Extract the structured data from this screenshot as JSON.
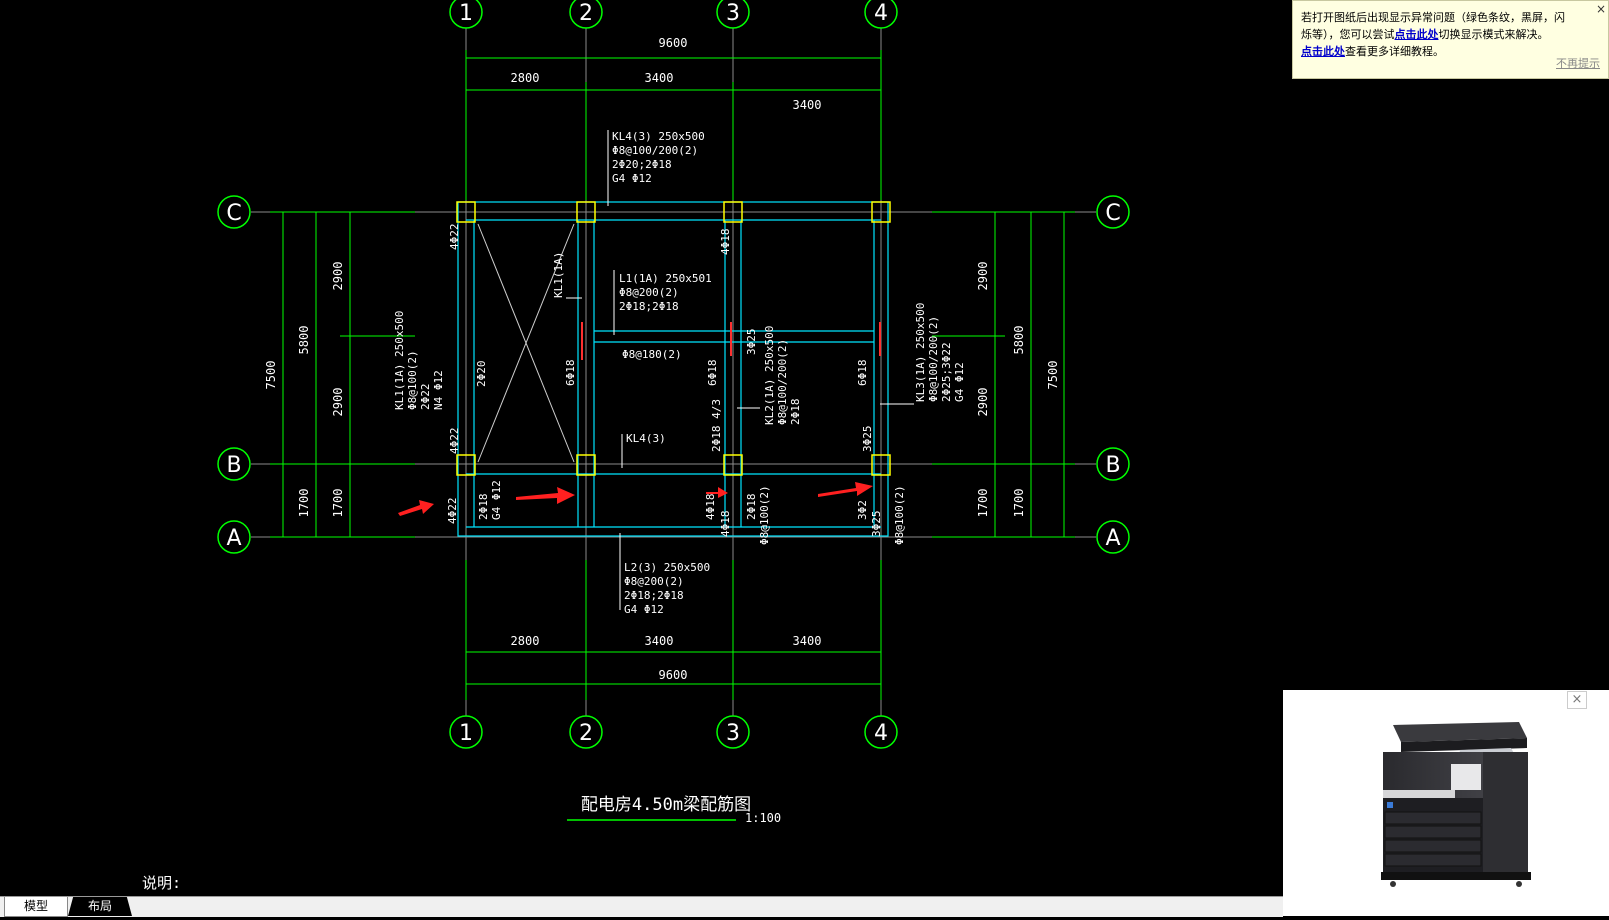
{
  "drawing": {
    "grid_labels": {
      "x": [
        "1",
        "2",
        "3",
        "4"
      ],
      "y": [
        "C",
        "B",
        "A"
      ]
    },
    "dims_top": {
      "total": "9600",
      "spans": [
        "2800",
        "3400",
        "3400"
      ]
    },
    "dims_bottom": {
      "total": "9600",
      "spans": [
        "2800",
        "3400",
        "3400"
      ]
    },
    "dims_left": {
      "total": "7500",
      "sub1": "5800",
      "parts": [
        "2900",
        "2900",
        "1700"
      ],
      "sub_a": "1700"
    },
    "dims_right": {
      "total": "7500",
      "sub1": "5800",
      "parts": [
        "2900",
        "2900",
        "1700"
      ],
      "sub_a": "1700"
    },
    "annotations": {
      "kl4_top": [
        "KL4(3) 250x500",
        "Φ8@100/200(2)",
        "2Φ20;2Φ18",
        "G4 Φ12"
      ],
      "l1": [
        "L1(1A) 250x501",
        "Φ8@200(2)",
        "2Φ18;2Φ18"
      ],
      "l1_stirrup": "Φ8@180(2)",
      "kl1_col2": "KL1(1A)",
      "kl1_left": [
        "KL1(1A) 250x500",
        "Φ8@100(2)",
        "2Φ22",
        "N4 Φ12"
      ],
      "kl2": [
        "KL2(1A) 250x500",
        "Φ8@100/200(2)",
        "2Φ18"
      ],
      "kl3": [
        "KL3(1A) 250x500",
        "Φ8@100/200(2)",
        "2Φ25;3Φ22",
        "G4 Φ12"
      ],
      "kl4_mid": "KL4(3)",
      "l2": [
        "L2(3) 250x500",
        "Φ8@200(2)",
        "2Φ18;2Φ18",
        "G4 Φ12"
      ],
      "rebar": [
        "4Φ22",
        "4Φ18",
        "2Φ20",
        "6Φ18",
        "6Φ18",
        "3Φ25",
        "2Φ18 4/3",
        "6Φ18",
        "3Φ25",
        "4Φ22",
        "4Φ22",
        "2Φ18",
        "G4 Φ12",
        "4Φ18",
        "4Φ18",
        "2Φ18",
        "Φ8@100(2)",
        "3Φ2",
        "3Φ25",
        "Φ8@100(2)"
      ]
    },
    "title": "配电房4.50m梁配筋图",
    "scale": "1:100",
    "note": "说明:"
  },
  "notice": {
    "line1": "若打开图纸后出现显示异常问题（绿色条纹，黑屏，闪",
    "line2_pre": "烁等），您可以尝试",
    "link1": "点击此处",
    "line2_post": "切换显示模式来解决。",
    "link2": "点击此处",
    "line3_post": "查看更多详细教程。",
    "dismiss": "不再提示",
    "close": "×"
  },
  "ad": {
    "close": "×"
  },
  "tabs": {
    "model": "模型",
    "layout": "布局"
  },
  "colors": {
    "axis": "#00ff00",
    "beam": "#00ffff",
    "column": "#ffff00",
    "arrow": "#ff2020",
    "background": "#000000"
  }
}
